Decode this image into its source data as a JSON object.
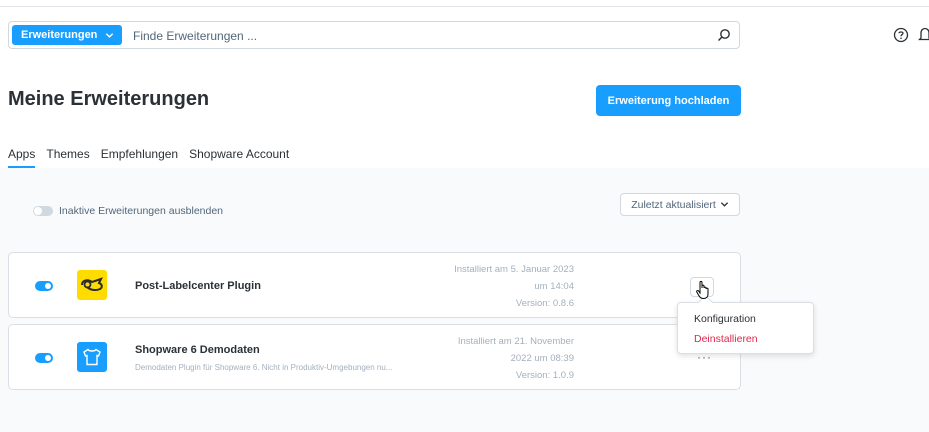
{
  "search": {
    "type_label": "Erweiterungen",
    "placeholder": "Finde Erweiterungen ..."
  },
  "header": {
    "title": "Meine Erweiterungen",
    "upload_label": "Erweiterung hochladen"
  },
  "tabs": [
    {
      "label": "Apps",
      "active": true
    },
    {
      "label": "Themes",
      "active": false
    },
    {
      "label": "Empfehlungen",
      "active": false
    },
    {
      "label": "Shopware Account",
      "active": false
    }
  ],
  "filter": {
    "toggle_label": "Inaktive Erweiterungen ausblenden",
    "sort_label": "Zuletzt aktualisiert"
  },
  "extensions": [
    {
      "name": "Post-Labelcenter Plugin",
      "description": "",
      "installed_line1": "Installiert am 5. Januar 2023",
      "installed_line2": "um 14:04",
      "version": "Version: 0.8.6",
      "active": true
    },
    {
      "name": "Shopware 6 Demodaten",
      "description": "Demodaten Plugin für Shopware 6. Nicht in Produktiv-Umgebungen nu...",
      "installed_line1": "Installiert am 21. November",
      "installed_line2": "2022 um 08:39",
      "version": "Version: 1.0.9",
      "active": true
    }
  ],
  "context_menu": {
    "items": [
      "Konfiguration",
      "Deinstallieren"
    ]
  },
  "colors": {
    "accent": "#189eff",
    "danger": "#de294c"
  },
  "icons": [
    "chevron-down-icon",
    "search-icon",
    "help-icon",
    "bell-icon",
    "post-horn-logo",
    "shirt-logo",
    "hand-cursor-icon"
  ]
}
